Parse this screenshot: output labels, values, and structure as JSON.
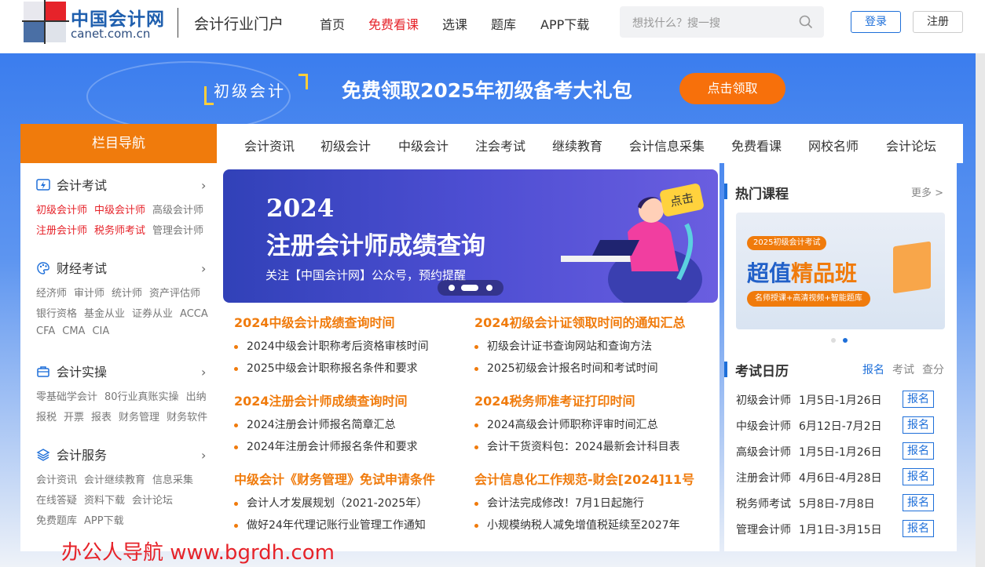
{
  "header": {
    "logo_title": "中国会计网",
    "logo_sub": "canet.com.cn",
    "portal": "会计行业门户",
    "nav": [
      {
        "label": "首页"
      },
      {
        "label": "免费看课"
      },
      {
        "label": "选课"
      },
      {
        "label": "题库"
      },
      {
        "label": "APP下载"
      }
    ],
    "search_placeholder": "想找什么？搜一搜",
    "login": "登录",
    "register": "注册",
    "accent_color": "#1e6fd9",
    "highlight_color": "#e6232a"
  },
  "banner": {
    "tag": "初级会计",
    "title": "免费领取2025年初级备考大礼包",
    "button": "点击领取",
    "button_color": "#f7700b"
  },
  "sidebar": {
    "title": "栏目导航",
    "title_color": "#f07b0c",
    "sections": [
      {
        "icon": "lightning-icon",
        "title": "会计考试",
        "rows": [
          [
            "初级会计师",
            "中级会计师",
            "高级会计师"
          ],
          [
            "注册会计师",
            "税务师考试",
            "管理会计师"
          ]
        ]
      },
      {
        "icon": "palette-icon",
        "title": "财经考试",
        "rows": [
          [
            "经济师",
            "审计师",
            "统计师",
            "资产评估师"
          ],
          [
            "银行资格",
            "基金从业",
            "证券从业",
            "ACCA"
          ],
          [
            "CFA",
            "CMA",
            "CIA"
          ]
        ]
      },
      {
        "icon": "briefcase-icon",
        "title": "会计实操",
        "rows": [
          [
            "零基础学会计",
            "80行业真账实操",
            "出纳"
          ],
          [
            "报税",
            "开票",
            "报表",
            "财务管理",
            "财务软件"
          ]
        ]
      },
      {
        "icon": "layers-icon",
        "title": "会计服务",
        "rows": [
          [
            "会计资讯",
            "会计继续教育",
            "信息采集"
          ],
          [
            "在线答疑",
            "资料下载",
            "会计论坛"
          ],
          [
            "免费题库",
            "APP下载"
          ]
        ]
      }
    ]
  },
  "topnav": [
    "会计资讯",
    "初级会计",
    "中级会计",
    "注会考试",
    "继续教育",
    "会计信息采集",
    "免费看课",
    "网校名师",
    "会计论坛"
  ],
  "carousel": {
    "year": "2024",
    "title": "注册会计师成绩查询",
    "subtitle": "关注【中国会计网】公众号，预约提醒",
    "tag": "点击"
  },
  "news": [
    {
      "title": "2024中级会计成绩查询时间",
      "items": [
        "2024中级会计职称考后资格审核时间",
        "2025中级会计职称报名条件和要求"
      ]
    },
    {
      "title": "2024初级会计证领取时间的通知汇总",
      "items": [
        "初级会计证书查询网站和查询方法",
        "2025初级会计报名时间和考试时间"
      ]
    },
    {
      "title": "2024注册会计师成绩查询时间",
      "items": [
        "2024注册会计师报名简章汇总",
        "2024年注册会计师报名条件和要求"
      ]
    },
    {
      "title": "2024税务师准考证打印时间",
      "items": [
        "2024高级会计师职称评审时间汇总",
        "会计干货资料包：2024最新会计科目表"
      ]
    },
    {
      "title": "中级会计《财务管理》免试申请条件",
      "items": [
        "会计人才发展规划（2021-2025年）",
        "做好24年代理记账行业管理工作通知"
      ]
    },
    {
      "title": "会计信息化工作规范-财会[2024]11号",
      "items": [
        "会计法完成修改！7月1日起施行",
        "小规模纳税人减免增值税延续至2027年"
      ]
    }
  ],
  "hot": {
    "title": "热门课程",
    "more": "更多 >",
    "promo_pill": "2025初级会计考试",
    "promo_big_a": "超值",
    "promo_big_b": "精品班",
    "promo_strip": "名师授课+高清视频+智能题库"
  },
  "calendar": {
    "title": "考试日历",
    "tabs": [
      "报名",
      "考试",
      "查分"
    ],
    "rows": [
      {
        "name": "初级会计师",
        "date": "1月5日-1月26日",
        "action": "报名"
      },
      {
        "name": "中级会计师",
        "date": "6月12日-7月2日",
        "action": "报名"
      },
      {
        "name": "高级会计师",
        "date": "1月5日-1月26日",
        "action": "报名"
      },
      {
        "name": "注册会计师",
        "date": "4月6日-4月28日",
        "action": "报名"
      },
      {
        "name": "税务师考试",
        "date": "5月8日-7月8日",
        "action": "报名"
      },
      {
        "name": "管理会计师",
        "date": "1月1日-3月15日",
        "action": "报名"
      }
    ]
  },
  "watermark": "办公人导航 www.bgrdh.com"
}
